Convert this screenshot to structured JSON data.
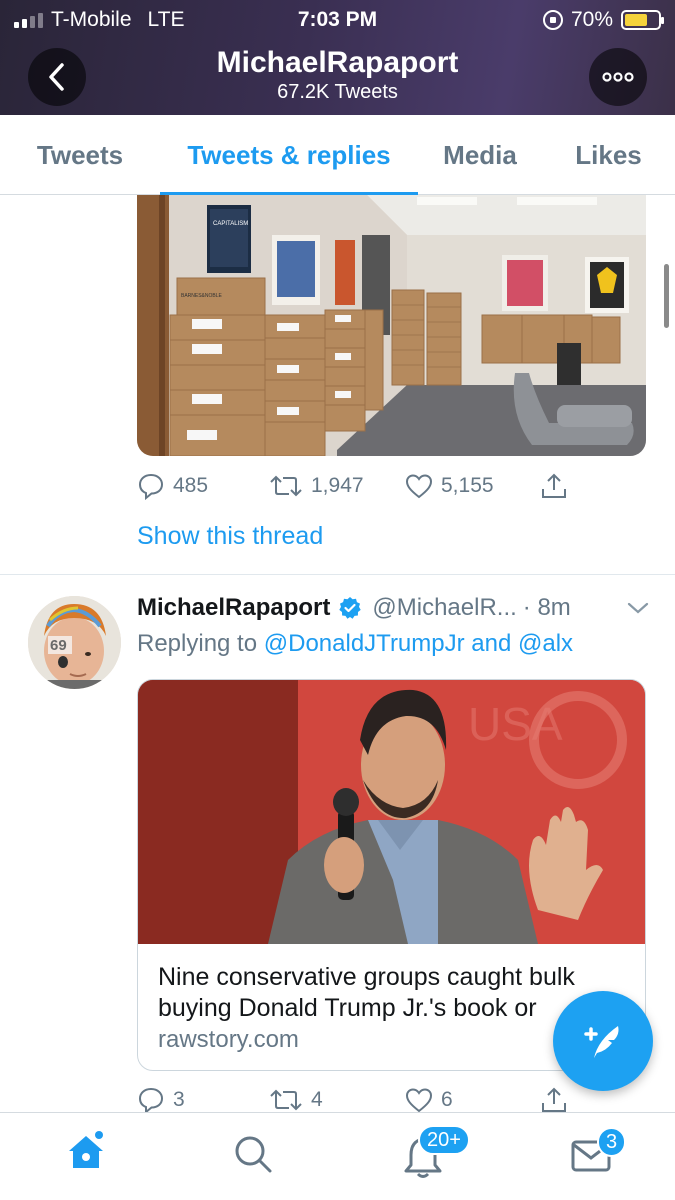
{
  "status_bar": {
    "carrier": "T-Mobile",
    "network": "LTE",
    "time": "7:03 PM",
    "battery": "70%"
  },
  "header": {
    "title": "MichaelRapaport",
    "subtitle": "67.2K Tweets",
    "back_icon": "chevron-left-icon",
    "more_icon": "more-dots-icon"
  },
  "tabs": [
    {
      "label": "Tweets",
      "active": false
    },
    {
      "label": "Tweets & replies",
      "active": true
    },
    {
      "label": "Media",
      "active": false
    },
    {
      "label": "Likes",
      "active": false
    }
  ],
  "tweet1": {
    "image_signs": {
      "poster_left": "CAPITALISM",
      "box_label": "BARNES&NOBLE"
    },
    "replies": "485",
    "retweets": "1,947",
    "likes": "5,155",
    "show_thread": "Show this thread"
  },
  "tweet2": {
    "name": "MichaelRapaport",
    "handle": "@MichaelR...",
    "time": "· 8m",
    "replying_prefix": "Replying to",
    "replying_user1": "@DonaldJTrumpJr",
    "replying_and": "and",
    "replying_user2": "@alx",
    "card": {
      "title": "Nine conservative groups caught bulk buying Donald Trump Jr.'s book or",
      "domain": "rawstory.com"
    },
    "replies": "3",
    "retweets": "4",
    "likes": "6"
  },
  "nav": {
    "home_icon": "home-icon",
    "search_icon": "search-icon",
    "notifications_icon": "bell-icon",
    "notifications_badge": "20+",
    "messages_icon": "mail-icon",
    "messages_badge": "3"
  },
  "colors": {
    "accent": "#1d9bf0",
    "muted": "#657786",
    "header_bg": "#3a2f52"
  }
}
